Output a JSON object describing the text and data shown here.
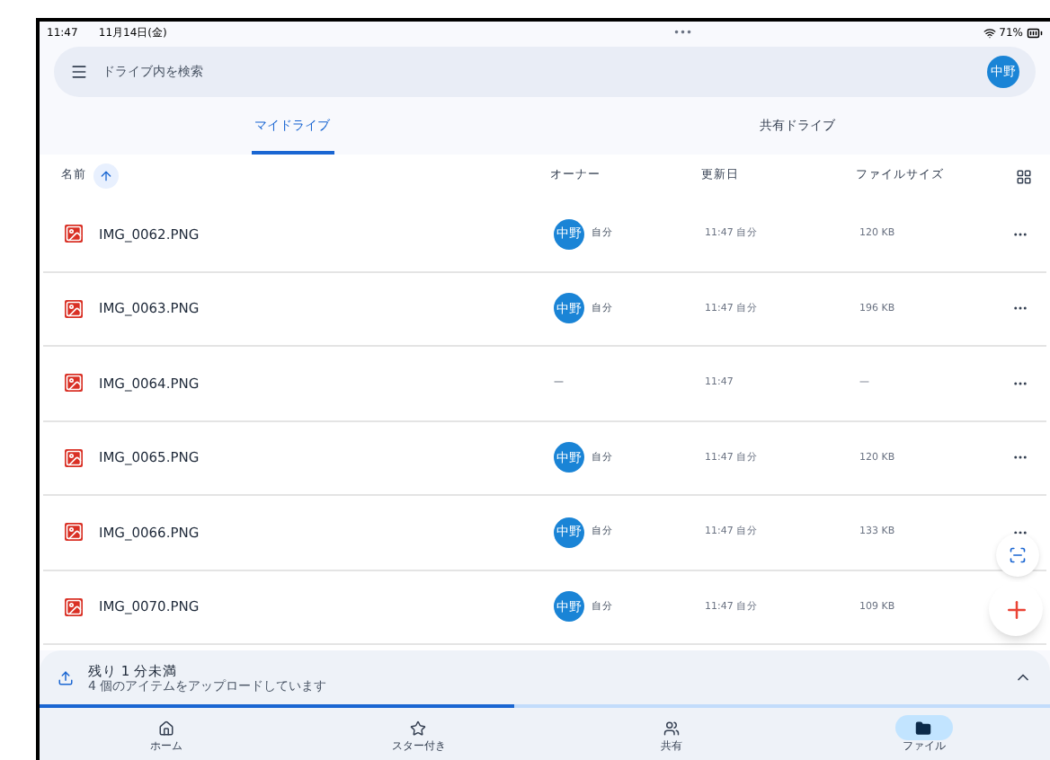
{
  "status_bar": {
    "time": "11:47",
    "date": "11月14日(金)",
    "dots": "•••",
    "battery": "71%"
  },
  "search": {
    "placeholder": "ドライブ内を検索",
    "avatar": "中野"
  },
  "tabs": [
    {
      "label": "マイドライブ",
      "selected": true
    },
    {
      "label": "共有ドライブ",
      "selected": false
    }
  ],
  "columns": {
    "name": "名前",
    "owner": "オーナー",
    "modified": "更新日",
    "size": "ファイルサイズ"
  },
  "files": [
    {
      "name": "IMG_0062.PNG",
      "owner_avatar": "中野",
      "owner": "自分",
      "modified": "11:47 自分",
      "size": "120 KB",
      "more": true
    },
    {
      "name": "IMG_0063.PNG",
      "owner_avatar": "中野",
      "owner": "自分",
      "modified": "11:47 自分",
      "size": "196 KB",
      "more": true
    },
    {
      "name": "IMG_0064.PNG",
      "owner": "—",
      "modified": "11:47",
      "size": "—",
      "more": true
    },
    {
      "name": "IMG_0065.PNG",
      "owner_avatar": "中野",
      "owner": "自分",
      "modified": "11:47 自分",
      "size": "120 KB",
      "more": true
    },
    {
      "name": "IMG_0066.PNG",
      "owner_avatar": "中野",
      "owner": "自分",
      "modified": "11:47 自分",
      "size": "133 KB",
      "more": true
    },
    {
      "name": "IMG_0070.PNG",
      "owner_avatar": "中野",
      "owner": "自分",
      "modified": "11:47 自分",
      "size": "109 KB",
      "more": false
    }
  ],
  "upload": {
    "title": "残り 1 分未満",
    "subtitle": "4 個のアイテムをアップロードしています",
    "level": 0.47
  },
  "nav": [
    {
      "label": "ホーム",
      "selected": false
    },
    {
      "label": "スター付き",
      "selected": false
    },
    {
      "label": "共有",
      "selected": false
    },
    {
      "label": "ファイル",
      "selected": true
    }
  ]
}
